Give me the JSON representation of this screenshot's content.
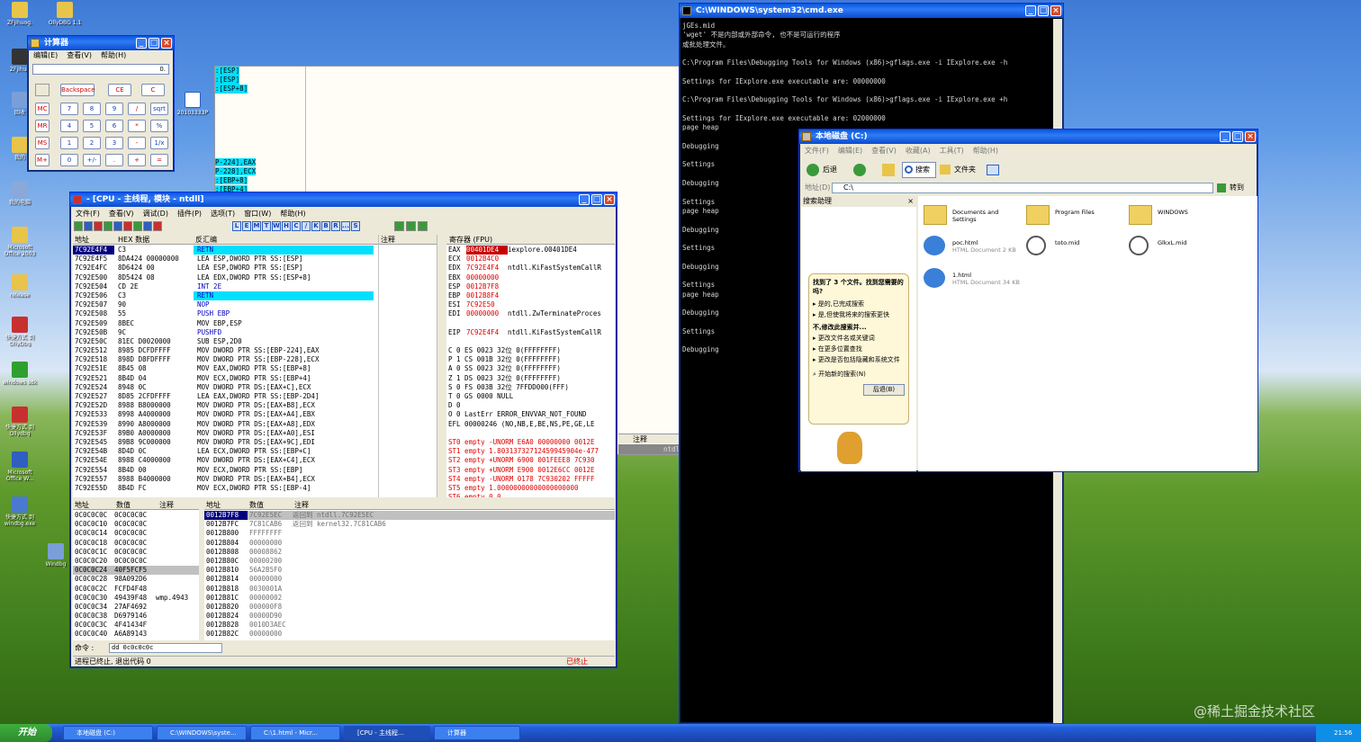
{
  "desktop": {
    "icons": [
      "ZFjihuog.",
      "OllyDBG 1.1",
      "ZFjihuo",
      "回收",
      "我的",
      "我的电脑",
      "Microsoft Office 2003",
      "release",
      "快捷方式 到 OllyDbg",
      "快捷方式 到 Ollydbg",
      "windows sdk",
      "Microsoft Office W...",
      "快捷方式 到 windbg.exe",
      "Windbg",
      "20103333P"
    ]
  },
  "calc": {
    "title": "计算器",
    "menu": [
      "编辑(E)",
      "查看(V)",
      "帮助(H)"
    ],
    "display": "0.",
    "buttons": [
      "Backspace",
      "CE",
      "C",
      "MC",
      "7",
      "8",
      "9",
      "/",
      "sqrt",
      "MR",
      "4",
      "5",
      "6",
      "*",
      "%",
      "MS",
      "1",
      "2",
      "3",
      "-",
      "1/x",
      "M+",
      "0",
      "+/-",
      ".",
      "+",
      "="
    ]
  },
  "dbg_bg": {
    "lines": [
      ":[ESP]",
      ":[ESP]",
      ":[ESP+8]",
      "P-224],EAX",
      "P-228],ECX",
      ":[EBP+8]",
      ":[EBP+4]"
    ]
  },
  "olly": {
    "title": "- [CPU - 主线程, 模块 - ntdll]",
    "menu": [
      "文件(F)",
      "查看(V)",
      "调试(D)",
      "插件(P)",
      "选项(T)",
      "窗口(W)",
      "帮助(H)"
    ],
    "letters": [
      "L",
      "E",
      "M",
      "T",
      "W",
      "H",
      "C",
      "/",
      "K",
      "B",
      "R",
      "...",
      "S"
    ],
    "disasm_headers": [
      "地址",
      "HEX 数据",
      "反汇编",
      "注释"
    ],
    "disasm": [
      [
        "7C92E4F4",
        "C3",
        "RETN"
      ],
      [
        "7C92E4F5",
        "8DA424 00000000",
        "LEA ESP,DWORD PTR SS:[ESP]"
      ],
      [
        "7C92E4FC",
        "8D6424 00",
        "LEA ESP,DWORD PTR SS:[ESP]"
      ],
      [
        "7C92E500",
        "8D5424 08",
        "LEA EDX,DWORD PTR SS:[ESP+8]"
      ],
      [
        "7C92E504",
        "CD 2E",
        "INT 2E"
      ],
      [
        "7C92E506",
        "C3",
        "RETN"
      ],
      [
        "7C92E507",
        "90",
        "NOP"
      ],
      [
        "7C92E508",
        "55",
        "PUSH EBP"
      ],
      [
        "7C92E509",
        "8BEC",
        "MOV EBP,ESP"
      ],
      [
        "7C92E50B",
        "9C",
        "PUSHFD"
      ],
      [
        "7C92E50C",
        "81EC D0020000",
        "SUB ESP,2D0"
      ],
      [
        "7C92E512",
        "8985 DCFDFFFF",
        "MOV DWORD PTR SS:[EBP-224],EAX"
      ],
      [
        "7C92E518",
        "898D D8FDFFFF",
        "MOV DWORD PTR SS:[EBP-228],ECX"
      ],
      [
        "7C92E51E",
        "8B45 08",
        "MOV EAX,DWORD PTR SS:[EBP+8]"
      ],
      [
        "7C92E521",
        "8B4D 04",
        "MOV ECX,DWORD PTR SS:[EBP+4]"
      ],
      [
        "7C92E524",
        "8948 0C",
        "MOV DWORD PTR DS:[EAX+C],ECX"
      ],
      [
        "7C92E527",
        "8D85 2CFDFFFF",
        "LEA EAX,DWORD PTR SS:[EBP-2D4]"
      ],
      [
        "7C92E52D",
        "8988 B8000000",
        "MOV DWORD PTR DS:[EAX+B8],ECX"
      ],
      [
        "7C92E533",
        "8998 A4000000",
        "MOV DWORD PTR DS:[EAX+A4],EBX"
      ],
      [
        "7C92E539",
        "8990 A8000000",
        "MOV DWORD PTR DS:[EAX+A8],EDX"
      ],
      [
        "7C92E53F",
        "89B0 A0000000",
        "MOV DWORD PTR DS:[EAX+A0],ESI"
      ],
      [
        "7C92E545",
        "89B8 9C000000",
        "MOV DWORD PTR DS:[EAX+9C],EDI"
      ],
      [
        "7C92E54B",
        "8D4D 0C",
        "LEA ECX,DWORD PTR SS:[EBP+C]"
      ],
      [
        "7C92E54E",
        "8988 C4000000",
        "MOV DWORD PTR DS:[EAX+C4],ECX"
      ],
      [
        "7C92E554",
        "8B4D 00",
        "MOV ECX,DWORD PTR SS:[EBP]"
      ],
      [
        "7C92E557",
        "8988 B4000000",
        "MOV DWORD PTR DS:[EAX+B4],ECX"
      ],
      [
        "7C92E55D",
        "8B4D FC",
        "MOV ECX,DWORD PTR SS:[EBP-4]"
      ]
    ],
    "reg_header": "寄存器 (FPU)",
    "regs": [
      [
        "EAX",
        "00401DE4",
        "iexplore.00401DE4"
      ],
      [
        "ECX",
        "0012B4C0",
        ""
      ],
      [
        "EDX",
        "7C92E4F4",
        "ntdll.KiFastSystemCallR"
      ],
      [
        "EBX",
        "00000000",
        ""
      ],
      [
        "ESP",
        "0012B7F8",
        ""
      ],
      [
        "EBP",
        "0012B8F4",
        ""
      ],
      [
        "ESI",
        "7C92E50",
        ""
      ],
      [
        "EDI",
        "00000000",
        "ntdll.ZwTerminateProces"
      ],
      [
        "",
        "",
        " "
      ],
      [
        "EIP",
        "7C92E4F4",
        "ntdll.KiFastSystemCallR"
      ]
    ],
    "flags": [
      "C 0  ES 0023 32位 0(FFFFFFFF)",
      "P 1  CS 001B 32位 0(FFFFFFFF)",
      "A 0  SS 0023 32位 0(FFFFFFFF)",
      "Z 1  DS 0023 32位 0(FFFFFFFF)",
      "S 0  FS 003B 32位 7FFDD000(FFF)",
      "T 0  GS 0000 NULL",
      "D 0",
      "O 0  LastErr ERROR_ENVVAR_NOT_FOUND",
      "EFL 00000246 (NO,NB,E,BE,NS,PE,GE,LE"
    ],
    "fpu": [
      "ST0 empty -UNORM E6A0 00000000 0012E",
      "ST1 empty 1.80313732712459945904e-477",
      "ST2 empty +UNORM 6900 001FEEE8 7C930",
      "ST3 empty +UNORM E900 0012E6CC 0012E",
      "ST4 empty -UNORM 0178 7C930202 FFFFF",
      "ST5 empty 1.00000000000000000000",
      "ST6 empty 0.0",
      "ST7 empty 1.0000000000000000000000"
    ],
    "dump_headers": [
      "地址",
      "数值",
      "注释"
    ],
    "dump": [
      [
        "0C0C0C0C",
        "0C0C0C0C",
        ""
      ],
      [
        "0C0C0C10",
        "0C0C0C0C",
        ""
      ],
      [
        "0C0C0C14",
        "0C0C0C0C",
        ""
      ],
      [
        "0C0C0C18",
        "0C0C0C0C",
        ""
      ],
      [
        "0C0C0C1C",
        "0C0C0C0C",
        ""
      ],
      [
        "0C0C0C20",
        "0C0C0C0C",
        ""
      ],
      [
        "0C0C0C24",
        "40F5FCF5",
        ""
      ],
      [
        "0C0C0C28",
        "98A092D6",
        ""
      ],
      [
        "0C0C0C2C",
        "FCFD4F48",
        ""
      ],
      [
        "0C0C0C30",
        "49439F48",
        "wmp.4943"
      ],
      [
        "0C0C0C34",
        "27AF4692",
        ""
      ],
      [
        "0C0C0C38",
        "D6979146",
        ""
      ],
      [
        "0C0C0C3C",
        "4F41434F",
        ""
      ],
      [
        "0C0C0C40",
        "A6A89143",
        ""
      ]
    ],
    "stack_headers": [
      "地址",
      "数值",
      "注释"
    ],
    "stack": [
      [
        "0012B7F8",
        "7C92E5EC",
        "返回到 ntdll.7C92E5EC"
      ],
      [
        "0012B7FC",
        "7C81CAB6",
        "返回到 kernel32.7C81CAB6"
      ],
      [
        "0012B800",
        "FFFFFFFF",
        ""
      ],
      [
        "0012B804",
        "00000000",
        ""
      ],
      [
        "0012B808",
        "00008862",
        ""
      ],
      [
        "0012B80C",
        "00000200",
        ""
      ],
      [
        "0012B810",
        "56A2B5F0",
        ""
      ],
      [
        "0012B814",
        "00000000",
        ""
      ],
      [
        "0012B818",
        "0030001A",
        ""
      ],
      [
        "0012B81C",
        "00000002",
        ""
      ],
      [
        "0012B820",
        "000000F8",
        ""
      ],
      [
        "0012B824",
        "00000D90",
        ""
      ],
      [
        "0012B828",
        "0010D3AEC",
        ""
      ],
      [
        "0012B82C",
        "00000000",
        ""
      ]
    ],
    "cmd_label": "命令 :",
    "cmd_value": "dd 0c0c0c0c",
    "status": "进程已终止, 退出代码 0",
    "status_right": "已终止"
  },
  "olly_bg": {
    "comment": "注释",
    "line": "ntdll.7C92E5EC"
  },
  "cmd": {
    "title": "C:\\WINDOWS\\system32\\cmd.exe",
    "lines": [
      "jGEs.mid",
      "'wget' 不是内部或外部命令, 也不是可运行的程序",
      "或批处理文件。",
      "",
      "C:\\Program Files\\Debugging Tools for Windows (x86)>gflags.exe -i IExplore.exe -h",
      "",
      "Settings for IExplore.exe executable are: 00000000",
      "",
      "C:\\Program Files\\Debugging Tools for Windows (x86)>gflags.exe -i IExplore.exe +h",
      "",
      "Settings for IExplore.exe executable are: 02000000",
      "page heap",
      "",
      "Debugging",
      "",
      "Settings",
      "",
      "Debugging",
      "",
      "Settings",
      "page heap",
      "",
      "Debugging",
      "",
      "Settings",
      "",
      "Debugging",
      "",
      "Settings",
      "page heap",
      "",
      "Debugging",
      "",
      "Settings",
      "",
      "Debugging"
    ]
  },
  "explorer": {
    "title": "本地磁盘 (C:)",
    "menu": [
      "文件(F)",
      "编辑(E)",
      "查看(V)",
      "收藏(A)",
      "工具(T)",
      "帮助(H)"
    ],
    "back": "后退",
    "search": "搜索",
    "folders": "文件夹",
    "address_label": "地址(D)",
    "address": "C:\\",
    "go": "转到",
    "pane_title": "搜索助理",
    "found": "找到了 3 个文件。找到您需要的吗?",
    "opts": [
      "是的,已完成搜索",
      "是,但使我将来的搜索更快"
    ],
    "no": "不,修改此搜索并...",
    "opts2": [
      "更改文件名或关键词",
      "在更多位置查找",
      "更改是否包括隐藏和系统文件"
    ],
    "restart": "开始新的搜索(N)",
    "back_btn": "后退(B)",
    "files": [
      {
        "name": "Documents and Settings",
        "sub": ""
      },
      {
        "name": "Program Files",
        "sub": ""
      },
      {
        "name": "WINDOWS",
        "sub": ""
      },
      {
        "name": "poc.html",
        "sub": "HTML Document 2 KB"
      },
      {
        "name": "toto.mid",
        "sub": ""
      },
      {
        "name": "GlkxL.mid",
        "sub": ""
      },
      {
        "name": "1.html",
        "sub": "HTML Document 34 KB"
      }
    ]
  },
  "taskbar": {
    "start": "开始",
    "items": [
      "本地磁盘 (C:)",
      "C:\\WINDOWS\\syste...",
      "C:\\1.html - Micr...",
      "[CPU - 主线程...",
      "计算器"
    ],
    "clock": "21:56"
  },
  "watermark": "@稀土掘金技术社区"
}
